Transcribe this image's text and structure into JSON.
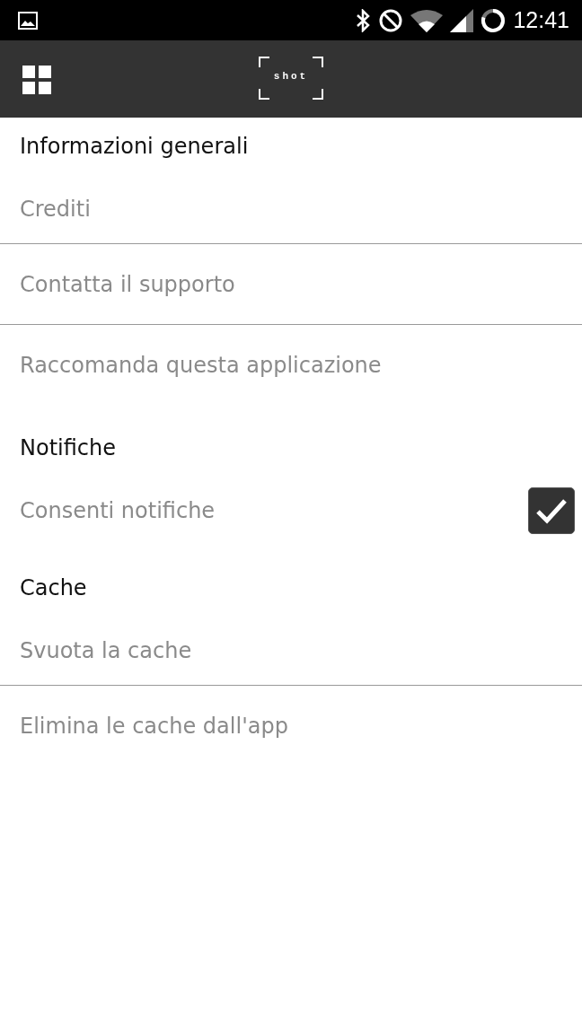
{
  "status_bar": {
    "time": "12:41"
  },
  "app_bar": {
    "logo_text": "shot"
  },
  "sections": [
    {
      "title": "Informazioni generali",
      "items": [
        {
          "label": "Crediti",
          "kind": "link"
        },
        {
          "label": "Contatta il supporto",
          "kind": "link"
        },
        {
          "label": "Raccomanda questa applicazione",
          "kind": "link"
        }
      ]
    },
    {
      "title": "Notifiche",
      "items": [
        {
          "label": "Consenti notifiche",
          "kind": "checkbox",
          "checked": true
        }
      ]
    },
    {
      "title": "Cache",
      "items": [
        {
          "label": "Svuota la cache",
          "kind": "link"
        },
        {
          "label": "Elimina le cache dall'app",
          "kind": "link"
        }
      ]
    }
  ]
}
